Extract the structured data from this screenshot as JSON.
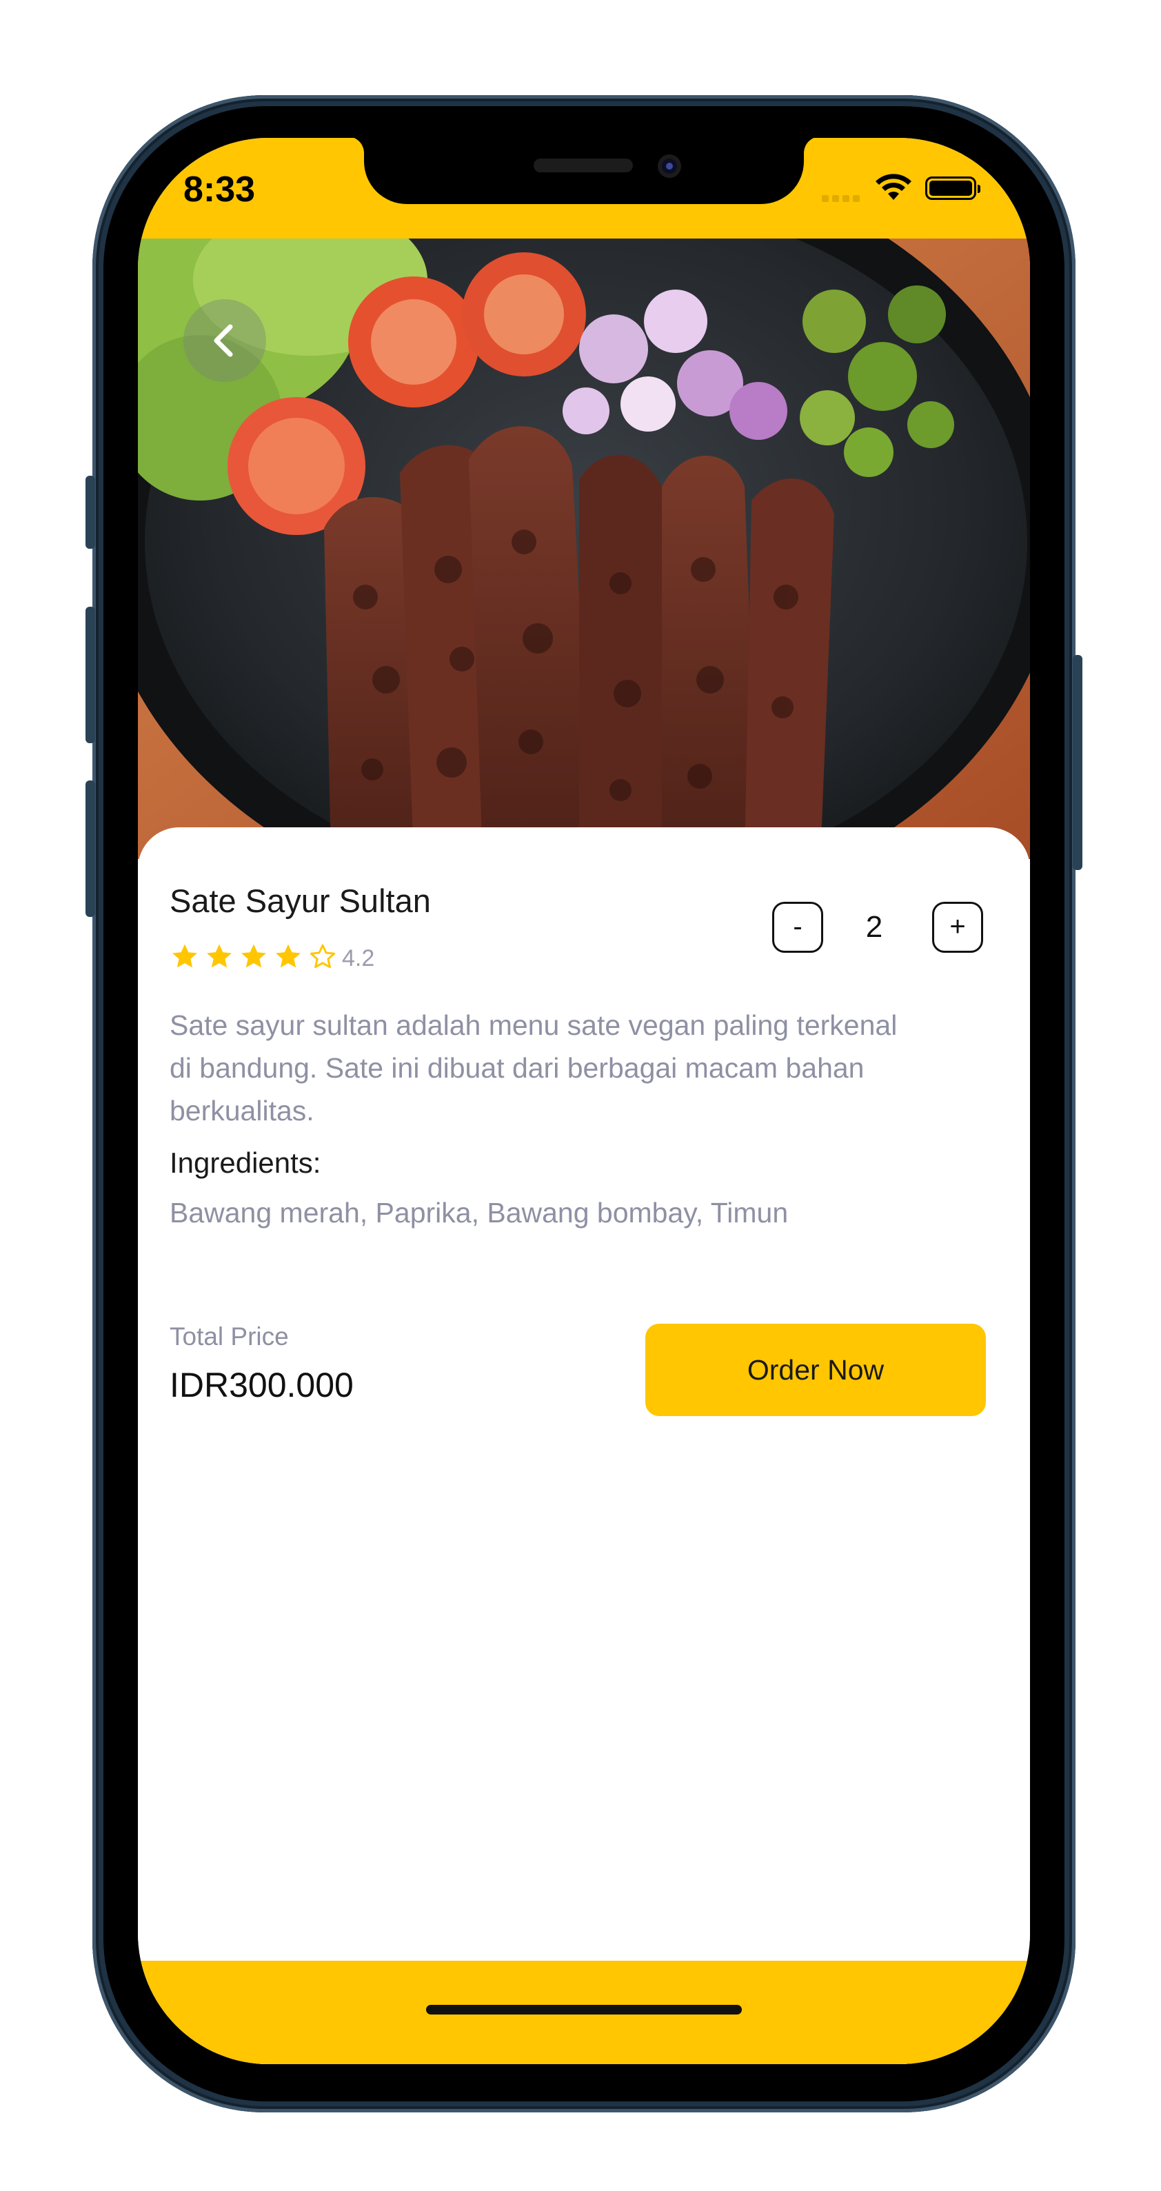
{
  "status_bar": {
    "time": "8:33"
  },
  "product": {
    "name": "Sate Sayur Sultan",
    "rating": "4.2",
    "rating_stars": {
      "filled": 4,
      "total": 5
    },
    "quantity": "2",
    "decrement_label": "-",
    "increment_label": "+",
    "description": "Sate sayur sultan adalah menu sate vegan paling terkenal di bandung. Sate ini dibuat dari berbagai macam bahan berkualitas.",
    "ingredients_label": "Ingredients:",
    "ingredients": "Bawang merah, Paprika, Bawang bombay, Timun"
  },
  "checkout": {
    "total_price_label": "Total Price",
    "total_price": "IDR300.000",
    "order_button_label": "Order Now"
  },
  "icons": {
    "back": "chevron-left-icon",
    "wifi": "wifi-icon",
    "battery": "battery-icon",
    "star": "star-icon"
  },
  "colors": {
    "accent": "#ffc601",
    "star": "#ffc601",
    "muted_text": "#8e90a3",
    "frame": "#1f3345"
  }
}
